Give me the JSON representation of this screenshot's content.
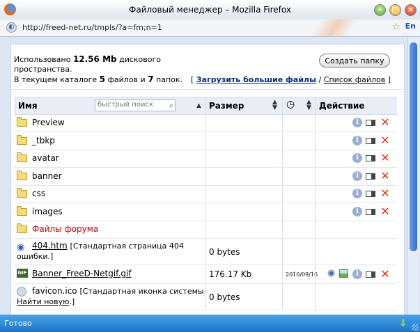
{
  "window": {
    "title": "Файловый менеджер – Mozilla Firefox"
  },
  "address": {
    "url": "http://freed-net.ru/tmpls/?a=fm;n=1",
    "lang": "En"
  },
  "info": {
    "line1_prefix": "Использовано",
    "used": "12.56 Mb",
    "line1_suffix": "дискового",
    "line2": "пространства.",
    "line3_prefix": "В текущем каталоге",
    "files_count": "5",
    "line3_mid": "файлов и",
    "folders_count": "7",
    "line3_suffix": "папок."
  },
  "buttons": {
    "create_folder": "Создать папку"
  },
  "links": {
    "open": "[",
    "upload": "Загрузить большие файлы",
    "sep": "/",
    "file_list": "Список файлов",
    "close": "]"
  },
  "table": {
    "col_name": "Имя",
    "search_placeholder": "быстрый поиск",
    "col_size": "Размер",
    "col_action": "Действие",
    "folders": [
      {
        "name": "Preview"
      },
      {
        "name": "_tbkp"
      },
      {
        "name": "avatar"
      },
      {
        "name": "banner"
      },
      {
        "name": "css"
      },
      {
        "name": "images"
      }
    ],
    "forum_folder": "Файлы форума",
    "files": [
      {
        "name": "404.htm",
        "desc": "[Стандартная страница 404",
        "desc2": "ошибки.]",
        "size": "0 bytes",
        "date": ""
      },
      {
        "name": "Banner_FreeD-Netgif.gif",
        "desc": "",
        "desc2": "",
        "size": "176.17 Kb",
        "date": "2010/09/16"
      },
      {
        "name": "favicon.ico",
        "desc": "[Стандартная иконка системы.",
        "desc2_link": "Найти новую",
        "desc2_tail": ".]",
        "size": "0 bytes",
        "date": ""
      }
    ]
  },
  "status": {
    "text": "Готово"
  },
  "colors": {
    "status_bar": "#1c73c8",
    "delete": "#d73a1a",
    "forum_folder": "#c00000"
  }
}
